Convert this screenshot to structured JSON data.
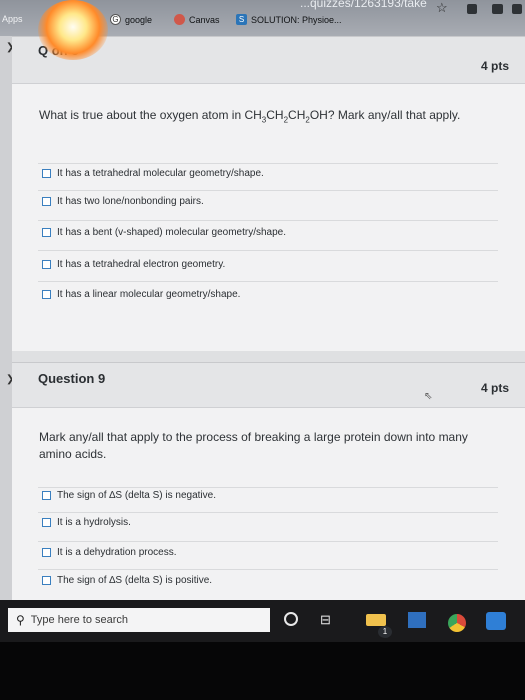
{
  "browser": {
    "url_fragment": "...quizzes/1263193/take",
    "bookmarks": {
      "apps_label": "Apps",
      "google_label": "google",
      "canvas_label": "Canvas",
      "solution_label": "SOLUTION: Physioe..."
    }
  },
  "question8": {
    "title_partial": "Q    on 8",
    "points": "4 pts",
    "prompt_pre": "What is true about the oxygen atom in CH",
    "sub1": "3",
    "mid1": "CH",
    "sub2": "2",
    "mid2": "CH",
    "sub3": "2",
    "prompt_post": "OH? Mark any/all that apply.",
    "options": [
      "It has a tetrahedral molecular geometry/shape.",
      "It has two lone/nonbonding pairs.",
      "It has a bent (v-shaped) molecular geometry/shape.",
      "It has a tetrahedral electron geometry.",
      "It has a linear molecular geometry/shape."
    ]
  },
  "question9": {
    "title": "Question 9",
    "points": "4 pts",
    "prompt": "Mark any/all that apply to the process of breaking a large protein down into many amino acids.",
    "options": [
      "The sign of ∆S (delta S) is negative.",
      "It is a hydrolysis.",
      "It is a dehydration process.",
      "The sign of ∆S (delta S) is positive."
    ]
  },
  "taskbar": {
    "search_placeholder": "Type here to search",
    "badge_count": "1"
  },
  "icons": [
    "search-icon",
    "cortana-circle-icon",
    "task-view-icon",
    "file-explorer-icon",
    "store-icon",
    "chrome-icon",
    "mail-icon"
  ]
}
